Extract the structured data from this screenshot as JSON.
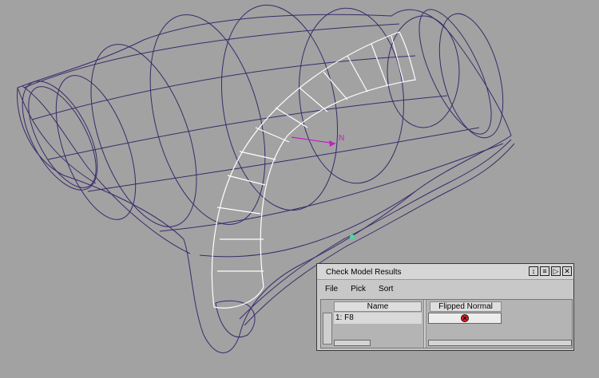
{
  "viewport": {
    "normal_label": "N",
    "colors": {
      "background": "#a2a2a2",
      "wire": "#3a2a6a",
      "selection": "#ffffff",
      "normal": "#c020c0",
      "marker": "#40e0a0"
    }
  },
  "panel": {
    "title": "Check Model Results",
    "title_buttons": [
      "resize-icon",
      "list-icon",
      "play-icon",
      "close-icon"
    ],
    "menu": [
      "File",
      "Pick",
      "Sort"
    ],
    "columns": {
      "name": "Name",
      "flipped": "Flipped Normal"
    },
    "rows": [
      {
        "name": "1: F8",
        "flipped_status": "error-icon"
      }
    ]
  }
}
